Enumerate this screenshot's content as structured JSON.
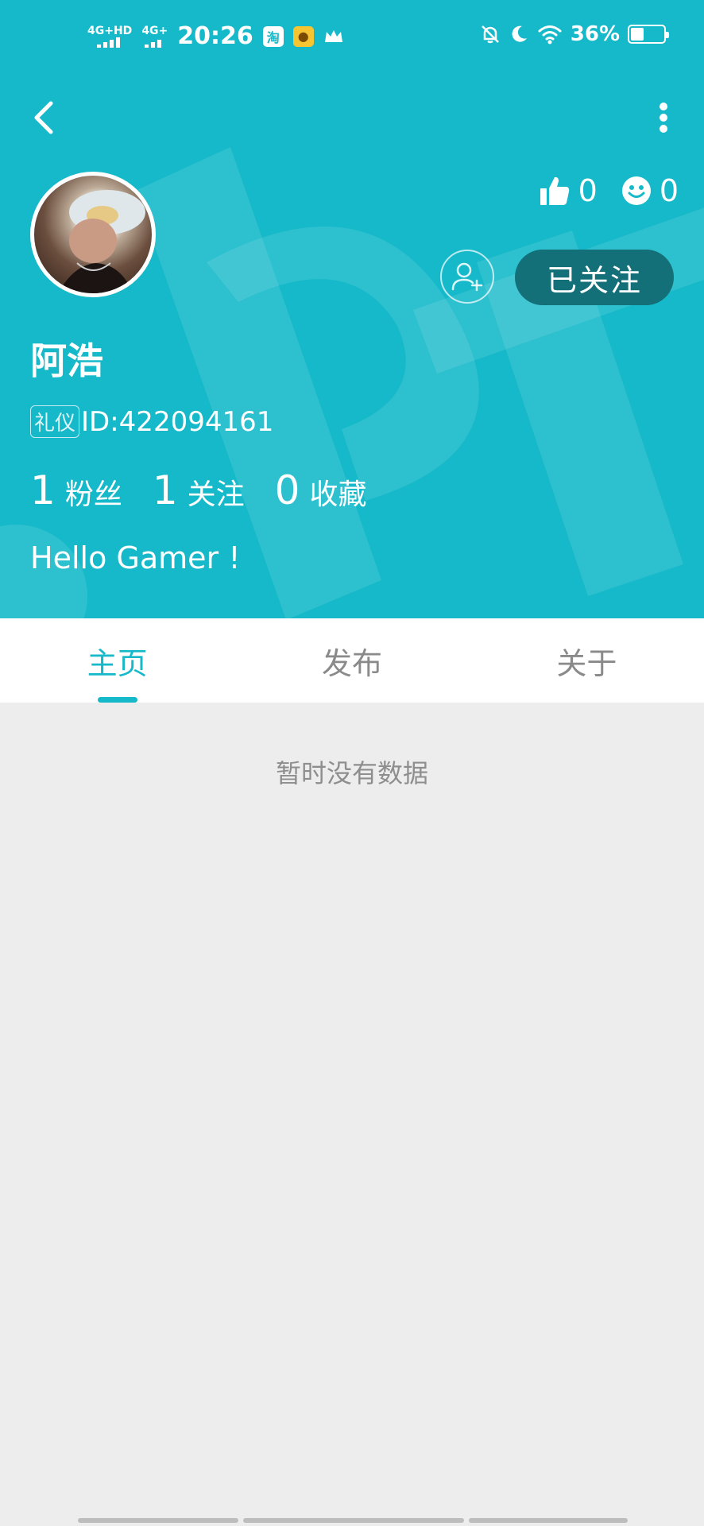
{
  "status_bar": {
    "network1": "4G+HD",
    "network2": "4G+",
    "time": "20:26",
    "app1": "淘",
    "battery_pct": "36%",
    "icons": [
      "signal-icon",
      "taobao-app-icon",
      "game-app-icon",
      "crown-icon",
      "bell-off-icon",
      "moon-icon",
      "wifi-icon",
      "battery-icon"
    ]
  },
  "profile": {
    "name": "阿浩",
    "tag": "礼仪",
    "id": "ID:422094161",
    "likes": "0",
    "smiles": "0",
    "follow_label": "已关注",
    "bio": "Hello Gamer !",
    "fans_count": "1",
    "fans_label": "粉丝",
    "following_count": "1",
    "following_label": "关注",
    "favorites_count": "0",
    "favorites_label": "收藏"
  },
  "tabs": [
    {
      "label": "主页",
      "active": true
    },
    {
      "label": "发布",
      "active": false
    },
    {
      "label": "关于",
      "active": false
    }
  ],
  "content": {
    "empty_text": "暂时没有数据"
  },
  "colors": {
    "header_bg": "#16b9c9",
    "follow_btn_bg": "#136f78",
    "page_bg": "#ededed"
  }
}
